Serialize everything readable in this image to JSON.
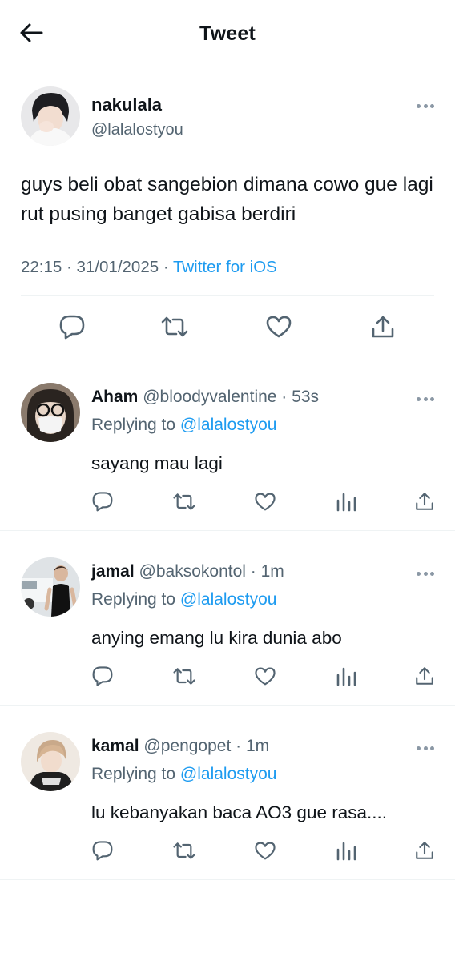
{
  "header": {
    "title": "Tweet"
  },
  "main_tweet": {
    "name": "nakulala",
    "handle": "@lalalostyou",
    "text": "guys beli obat sangebion dimana cowo gue lagi rut pusing banget gabisa berdiri",
    "timestamp": "22:15 · 31/01/2025",
    "separator": " · ",
    "source": "Twitter for iOS"
  },
  "replies": [
    {
      "name": "Aham",
      "handle": "@bloodyvalentine",
      "time": "53s",
      "replying_label": "Replying to ",
      "mention": "@lalalostyou",
      "text": "sayang mau lagi"
    },
    {
      "name": "jamal",
      "handle": "@baksokontol",
      "time": "1m",
      "replying_label": "Replying to ",
      "mention": "@lalalostyou",
      "text": "anying emang lu kira dunia abo"
    },
    {
      "name": "kamal",
      "handle": "@pengopet",
      "time": "1m",
      "replying_label": "Replying to ",
      "mention": "@lalalostyou",
      "text": "lu kebanyakan baca AO3 gue rasa...."
    }
  ],
  "icons": {
    "back": "back-arrow-icon",
    "more": "more-dots-icon",
    "reply": "reply-icon",
    "retweet": "retweet-icon",
    "like": "heart-icon",
    "views": "views-icon",
    "share": "share-icon"
  },
  "colors": {
    "text": "#0f1419",
    "secondary": "#536471",
    "link": "#1d9bf0",
    "divider": "#eff3f4"
  }
}
